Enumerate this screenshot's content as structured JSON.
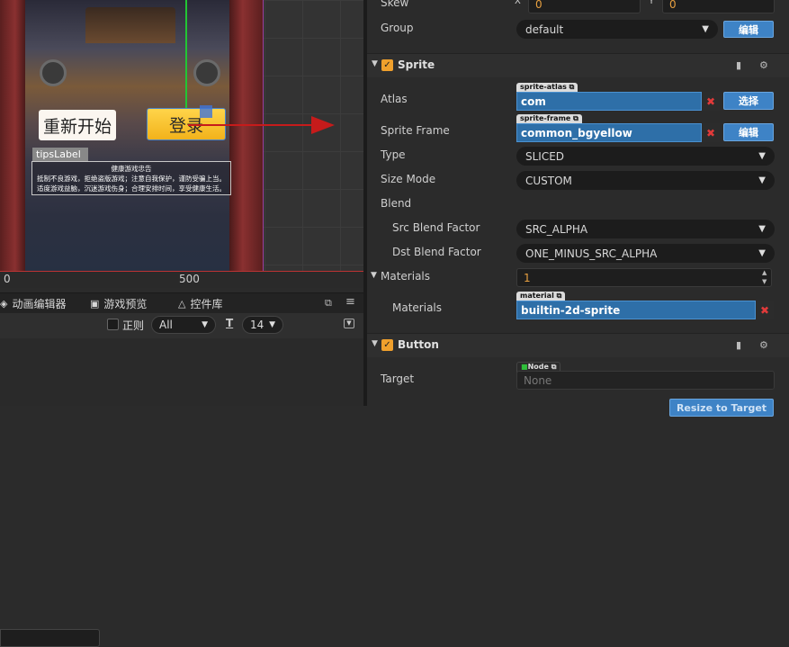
{
  "scene": {
    "restart_label": "重新开始",
    "login_label": "登录",
    "tips_tab": "tipsLabel",
    "tips_title": "健康游戏忠告",
    "tips_line1": "抵制不良游戏，拒绝盗版游戏；注意自我保护，谨防受骗上当。",
    "tips_line2": "适度游戏益脑，沉迷游戏伤身；合理安排时间，享受健康生活。",
    "ruler_0": "0",
    "ruler_500": "500"
  },
  "bottom_panel": {
    "tabs": [
      {
        "label": "动画编辑器",
        "icon": "animation-icon"
      },
      {
        "label": "游戏预览",
        "icon": "preview-icon"
      },
      {
        "label": "控件库",
        "icon": "widget-library-icon"
      }
    ],
    "regex_label": "正则",
    "filter_value": "All",
    "font_size_value": "14"
  },
  "inspector": {
    "skew": {
      "label": "Skew",
      "x_label": "X",
      "x_value": "0",
      "y_label": "Y",
      "y_value": "0"
    },
    "group": {
      "label": "Group",
      "value": "default",
      "edit_btn": "编辑"
    },
    "sprite_section": {
      "title": "Sprite"
    },
    "atlas": {
      "label": "Atlas",
      "tag": "sprite-atlas",
      "value": "com",
      "select_btn": "选择"
    },
    "sprite_frame": {
      "label": "Sprite Frame",
      "tag": "sprite-frame",
      "value": "common_bgyellow",
      "edit_btn": "编辑"
    },
    "type": {
      "label": "Type",
      "value": "SLICED"
    },
    "size_mode": {
      "label": "Size Mode",
      "value": "CUSTOM"
    },
    "blend": {
      "label": "Blend"
    },
    "src_blend": {
      "label": "Src Blend Factor",
      "value": "SRC_ALPHA"
    },
    "dst_blend": {
      "label": "Dst Blend Factor",
      "value": "ONE_MINUS_SRC_ALPHA"
    },
    "materials_count": {
      "label": "Materials",
      "value": "1"
    },
    "materials_item": {
      "label": "Materials",
      "tag": "material",
      "value": "builtin-2d-sprite"
    },
    "button_section": {
      "title": "Button"
    },
    "target": {
      "label": "Target",
      "tag": "Node",
      "placeholder": "None"
    },
    "resize_btn": "Resize to Target"
  },
  "colors": {
    "accent_blue": "#3e83c6",
    "check_orange": "#f0a02c",
    "clear_red": "#e23a3a",
    "arrow_red": "#c61b1b"
  }
}
